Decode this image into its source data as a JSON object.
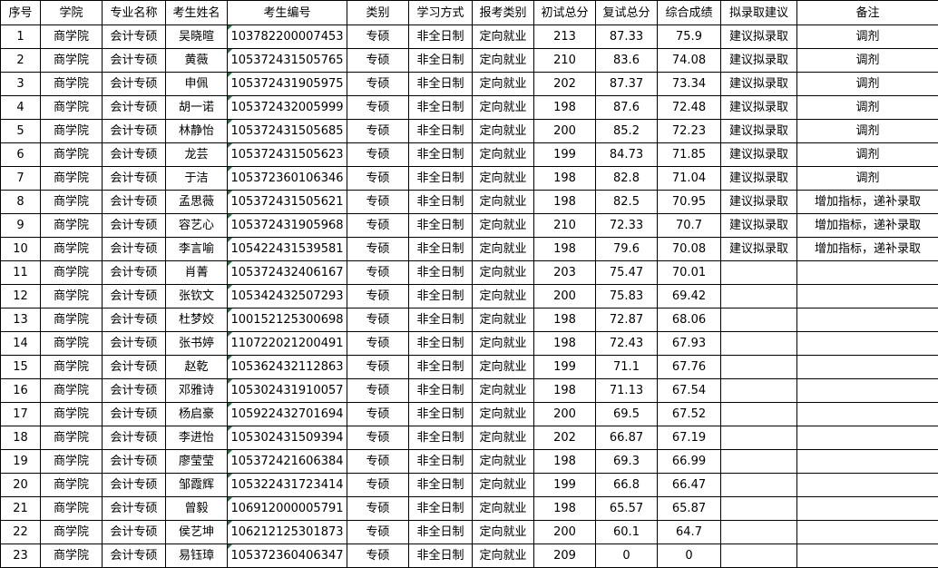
{
  "headers": [
    "序号",
    "学院",
    "专业名称",
    "考生姓名",
    "考生编号",
    "类别",
    "学习方式",
    "报考类别",
    "初试总分",
    "复试总分",
    "综合成绩",
    "拟录取建议",
    "备注"
  ],
  "rows": [
    [
      "1",
      "商学院",
      "会计专硕",
      "吴晓暄",
      "103782200007453",
      "专硕",
      "非全日制",
      "定向就业",
      "213",
      "87.33",
      "75.9",
      "建议拟录取",
      "调剂"
    ],
    [
      "2",
      "商学院",
      "会计专硕",
      "黄薇",
      "105372431505765",
      "专硕",
      "非全日制",
      "定向就业",
      "210",
      "83.6",
      "74.08",
      "建议拟录取",
      "调剂"
    ],
    [
      "3",
      "商学院",
      "会计专硕",
      "申佩",
      "105372431905975",
      "专硕",
      "非全日制",
      "定向就业",
      "202",
      "87.37",
      "73.34",
      "建议拟录取",
      "调剂"
    ],
    [
      "4",
      "商学院",
      "会计专硕",
      "胡一诺",
      "105372432005999",
      "专硕",
      "非全日制",
      "定向就业",
      "198",
      "87.6",
      "72.48",
      "建议拟录取",
      "调剂"
    ],
    [
      "5",
      "商学院",
      "会计专硕",
      "林静怡",
      "105372431505685",
      "专硕",
      "非全日制",
      "定向就业",
      "200",
      "85.2",
      "72.23",
      "建议拟录取",
      "调剂"
    ],
    [
      "6",
      "商学院",
      "会计专硕",
      "龙芸",
      "105372431505623",
      "专硕",
      "非全日制",
      "定向就业",
      "199",
      "84.73",
      "71.85",
      "建议拟录取",
      "调剂"
    ],
    [
      "7",
      "商学院",
      "会计专硕",
      "于洁",
      "105372360106346",
      "专硕",
      "非全日制",
      "定向就业",
      "198",
      "82.8",
      "71.04",
      "建议拟录取",
      "调剂"
    ],
    [
      "8",
      "商学院",
      "会计专硕",
      "孟思薇",
      "105372431505621",
      "专硕",
      "非全日制",
      "定向就业",
      "198",
      "82.5",
      "70.95",
      "建议拟录取",
      "增加指标，递补录取"
    ],
    [
      "9",
      "商学院",
      "会计专硕",
      "容艺心",
      "105372431905968",
      "专硕",
      "非全日制",
      "定向就业",
      "210",
      "72.33",
      "70.7",
      "建议拟录取",
      "增加指标，递补录取"
    ],
    [
      "10",
      "商学院",
      "会计专硕",
      "李言喻",
      "105422431539581",
      "专硕",
      "非全日制",
      "定向就业",
      "198",
      "79.6",
      "70.08",
      "建议拟录取",
      "增加指标，递补录取"
    ],
    [
      "11",
      "商学院",
      "会计专硕",
      "肖菁",
      "105372432406167",
      "专硕",
      "非全日制",
      "定向就业",
      "203",
      "75.47",
      "70.01",
      "",
      ""
    ],
    [
      "12",
      "商学院",
      "会计专硕",
      "张钦文",
      "105342432507293",
      "专硕",
      "非全日制",
      "定向就业",
      "200",
      "75.83",
      "69.42",
      "",
      ""
    ],
    [
      "13",
      "商学院",
      "会计专硕",
      "杜梦姣",
      "100152125300698",
      "专硕",
      "非全日制",
      "定向就业",
      "198",
      "72.87",
      "68.06",
      "",
      ""
    ],
    [
      "14",
      "商学院",
      "会计专硕",
      "张书婷",
      "110722021200491",
      "专硕",
      "非全日制",
      "定向就业",
      "198",
      "72.43",
      "67.93",
      "",
      ""
    ],
    [
      "15",
      "商学院",
      "会计专硕",
      "赵乾",
      "105362432112863",
      "专硕",
      "非全日制",
      "定向就业",
      "199",
      "71.1",
      "67.76",
      "",
      ""
    ],
    [
      "16",
      "商学院",
      "会计专硕",
      "邓雅诗",
      "105302431910057",
      "专硕",
      "非全日制",
      "定向就业",
      "198",
      "71.13",
      "67.54",
      "",
      ""
    ],
    [
      "17",
      "商学院",
      "会计专硕",
      "杨启豪",
      "105922432701694",
      "专硕",
      "非全日制",
      "定向就业",
      "200",
      "69.5",
      "67.52",
      "",
      ""
    ],
    [
      "18",
      "商学院",
      "会计专硕",
      "李进怡",
      "105302431509394",
      "专硕",
      "非全日制",
      "定向就业",
      "202",
      "66.87",
      "67.19",
      "",
      ""
    ],
    [
      "19",
      "商学院",
      "会计专硕",
      "廖莹莹",
      "105372421606384",
      "专硕",
      "非全日制",
      "定向就业",
      "198",
      "69.3",
      "66.99",
      "",
      ""
    ],
    [
      "20",
      "商学院",
      "会计专硕",
      "邹霞辉",
      "105322431723414",
      "专硕",
      "非全日制",
      "定向就业",
      "199",
      "66.8",
      "66.47",
      "",
      ""
    ],
    [
      "21",
      "商学院",
      "会计专硕",
      "曾毅",
      "106912000005791",
      "专硕",
      "非全日制",
      "定向就业",
      "198",
      "65.57",
      "65.87",
      "",
      ""
    ],
    [
      "22",
      "商学院",
      "会计专硕",
      "侯艺坤",
      "106212125301873",
      "专硕",
      "非全日制",
      "定向就业",
      "200",
      "60.1",
      "64.7",
      "",
      ""
    ],
    [
      "23",
      "商学院",
      "会计专硕",
      "易钰璋",
      "105372360406347",
      "专硕",
      "非全日制",
      "定向就业",
      "209",
      "0",
      "0",
      "",
      ""
    ]
  ]
}
